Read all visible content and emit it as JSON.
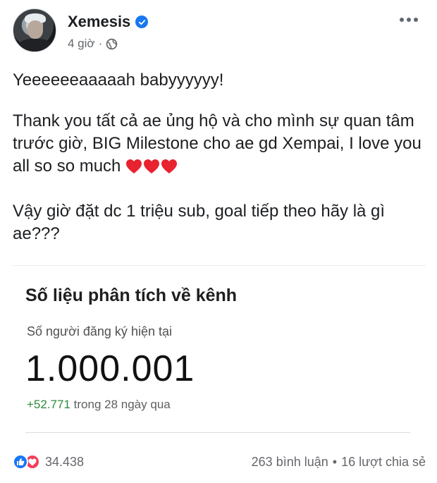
{
  "post": {
    "author": "Xemesis",
    "time": "4 giờ",
    "separator": "·",
    "paragraphs": [
      "Yeeeeeeaaaaah babyyyyyy!",
      "Thank you tất cả ae ủng hộ và cho mình sự quan tâm trước giờ, BIG Milestone cho ae gd Xempai, I love you all so so much",
      "Vậy giờ đặt dc 1 triệu sub, goal tiếp theo hãy là gì ae???"
    ]
  },
  "card": {
    "title": "Số liệu phân tích về kênh",
    "subtitle": "Số người đăng ký hiện tại",
    "value": "1.000.001",
    "growth": "+52.771",
    "growth_suffix": "trong 28 ngày qua"
  },
  "footer": {
    "reaction_count": "34.438",
    "comments": "263 bình luận",
    "dot": "•",
    "shares": "16 lượt chia sẻ"
  },
  "icons": [
    "verified-icon",
    "globe-icon",
    "more-icon",
    "heart-icon",
    "like-icon",
    "love-icon"
  ],
  "colors": {
    "facebook_blue": "#1877f2",
    "heart_red": "#e8222e",
    "love_red": "#f33e58",
    "growth_green": "#2e8b3c"
  }
}
